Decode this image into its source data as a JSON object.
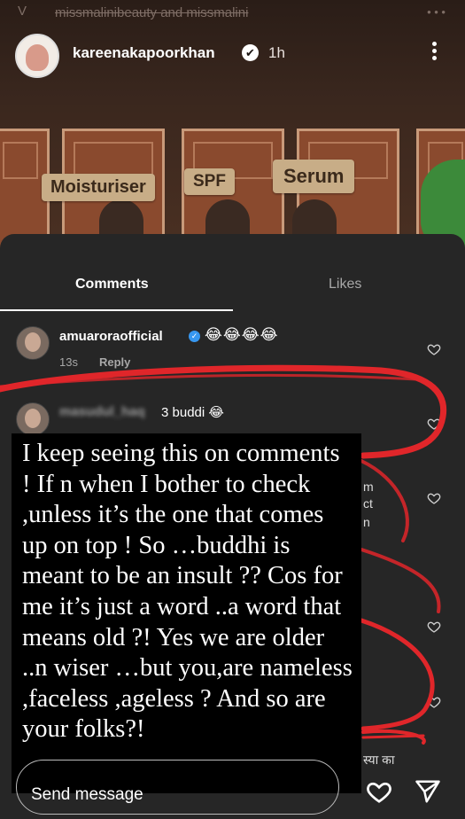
{
  "story": {
    "faded_header": "missmalinibeauty and missmalini",
    "faded_dots": "• • •",
    "faded_v": "V",
    "author": "kareenakapoorkhan",
    "verified_mark": "✔",
    "time": "1h",
    "tags": [
      "Moisturiser",
      "SPF",
      "Serum"
    ]
  },
  "tabs": {
    "comments": "Comments",
    "likes": "Likes"
  },
  "comments": [
    {
      "user": "amuarora​official",
      "emoji": "😂😂😂😂",
      "age": "13s",
      "reply": "Reply"
    },
    {
      "user": "masudul_haq",
      "text": "3 buddi 😂"
    }
  ],
  "partial_texts": [
    "m",
    "ct",
    "n",
    "स्या का"
  ],
  "note": {
    "text": "I keep seeing this on comments ! If n when I bother to check ,unless it’s the one that comes up on top ! So …buddhi is meant to be an insult ?? Cos for me it’s just a word ..a word that means old ?! Yes we are older ..n wiser …but you,are nameless ,faceless ,ageless ? And so are your folks?!"
  },
  "bottom": {
    "send_placeholder": "Send message"
  },
  "icons": {
    "heart": "heart-icon",
    "send": "send-icon",
    "more": "more-icon",
    "verified": "verified-icon"
  },
  "colors": {
    "sheet": "#262626",
    "scribble": "#e0262a",
    "verified_blue": "#3797f0"
  }
}
